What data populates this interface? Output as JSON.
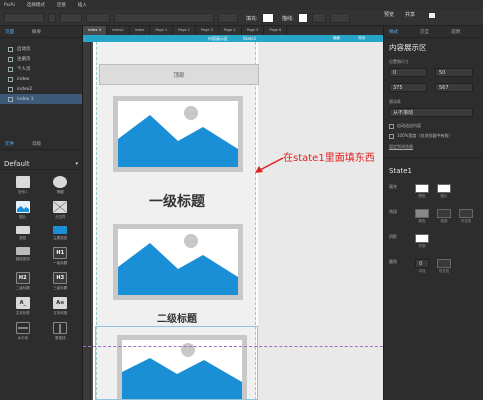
{
  "menubar": {
    "items": [
      "Ps/Ai",
      "选择模式",
      "连接",
      "插入"
    ]
  },
  "toolbar": {
    "fill_label": "填充:",
    "border_label": "描线:",
    "preview_label": "预览",
    "share_label": "共享",
    "zoom_value": "100%"
  },
  "left_panel": {
    "pages_tabs": [
      "页面",
      "概要"
    ],
    "pages": [
      {
        "label": "启动页",
        "selected": false
      },
      {
        "label": "注册页",
        "selected": false
      },
      {
        "label": "个人页",
        "selected": false
      },
      {
        "label": "index",
        "selected": false
      },
      {
        "label": "index2",
        "selected": false
      },
      {
        "label": "index 3",
        "selected": true
      }
    ],
    "library_tabs": [
      "元件",
      "母版"
    ],
    "library_name": "Default",
    "components": [
      {
        "icon": "box",
        "label": "矩形1"
      },
      {
        "icon": "circle",
        "label": "椭圆"
      },
      {
        "icon": "image",
        "label": "图片"
      },
      {
        "icon": "placeholder",
        "label": "占位符"
      },
      {
        "icon": "button",
        "label": "按钮"
      },
      {
        "icon": "button",
        "label": "主要按钮"
      },
      {
        "icon": "button",
        "label": "链接按钮"
      },
      {
        "icon": "H1",
        "label": "一级标题"
      },
      {
        "icon": "H2",
        "label": "二级标题"
      },
      {
        "icon": "H3",
        "label": "三级标题"
      },
      {
        "icon": "A_",
        "label": "文本标签"
      },
      {
        "icon": "A≡",
        "label": "文本段落"
      },
      {
        "icon": "hline",
        "label": "水平线"
      },
      {
        "icon": "vline",
        "label": "垂直线"
      }
    ]
  },
  "canvas": {
    "doc_tabs": [
      "index 3",
      "index2",
      "index",
      "Page 1",
      "Page 2",
      "Page 3",
      "Page 4",
      "Page 5",
      "Page 6"
    ],
    "panel_title": "内容展示区",
    "state_name": "State1",
    "panel_bar_right": [
      "隐藏",
      "关闭"
    ],
    "header_text": "顶部",
    "heading1": "一级标题",
    "heading2": "二级标题",
    "annotation": "在state1里面填东西"
  },
  "right_panel": {
    "tabs": [
      "样式",
      "交互",
      "说明"
    ],
    "title": "内容展示区",
    "position_label": "位置和尺寸",
    "x": "0",
    "y": "50",
    "w": "375",
    "h": "567",
    "scroll_label": "滚动条",
    "scroll_value": "从不滚动",
    "check1": "自动适应内容",
    "check2": "100%宽度（仅浏览器中有效）",
    "fixed_label": "固定到浏览器",
    "state_title": "State1",
    "fill_row_label": "填充",
    "fill_color_labels": [
      "颜色",
      "图片"
    ],
    "border_row_label": "线段",
    "border_labels": [
      "颜色",
      "线宽",
      "可见性"
    ],
    "shadow_row_label": "阴影",
    "shadow_labels": [
      "外部"
    ],
    "radius_row_label": "圆角",
    "radius_labels": [
      "半径",
      "可见性"
    ],
    "radius_value": "0"
  },
  "colors": {
    "panel_bar": "#27a5c9",
    "image_blue": "#1a8fd6",
    "annotation": "#e02020",
    "selection": "#3d5a78"
  }
}
